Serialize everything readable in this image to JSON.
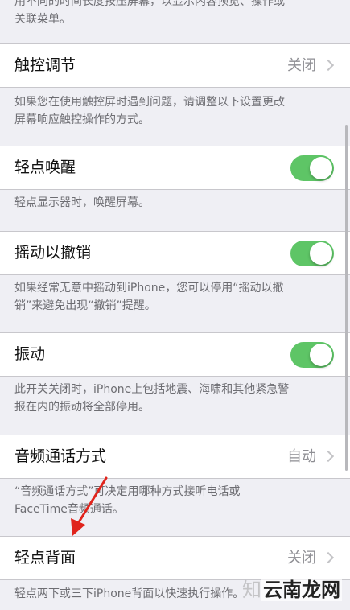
{
  "colors": {
    "background": "#efeff4",
    "toggle_on": "#5ec566",
    "arrow": "#e0241c"
  },
  "top_desc": {
    "line1": "用不同的时间长度按压屏幕，以显示内容预览、操作或",
    "line2": "关联菜单。"
  },
  "touch_adjust": {
    "label": "触控调节",
    "value": "关闭",
    "desc_line1": "如果您在使用触控屏时遇到问题，请调整以下设置更改",
    "desc_line2": "屏幕响应触控操作的方式。"
  },
  "tap_to_wake": {
    "label": "轻点唤醒",
    "on": true,
    "desc": "轻点显示器时，唤醒屏幕。"
  },
  "shake_to_undo": {
    "label": "摇动以撤销",
    "on": true,
    "desc_line1": "如果经常无意中摇动到iPhone，您可以停用“摇动以撤",
    "desc_line2": "销”来避免出现“撤销”提醒。"
  },
  "vibration": {
    "label": "振动",
    "on": true,
    "desc_line1": "此开关关闭时，iPhone上包括地震、海啸和其他紧急警",
    "desc_line2": "报在内的振动将全部停用。"
  },
  "call_audio": {
    "label": "音频通话方式",
    "value": "自动",
    "desc_line1": "“音频通话方式”可决定用哪种方式接听电话或",
    "desc_line2": "FaceTime音频通话。"
  },
  "back_tap": {
    "label": "轻点背面",
    "value": "关闭",
    "desc": "轻点两下或三下iPhone背面以快速执行操作。"
  },
  "watermark": {
    "main": "云南龙网",
    "faint": "知"
  }
}
